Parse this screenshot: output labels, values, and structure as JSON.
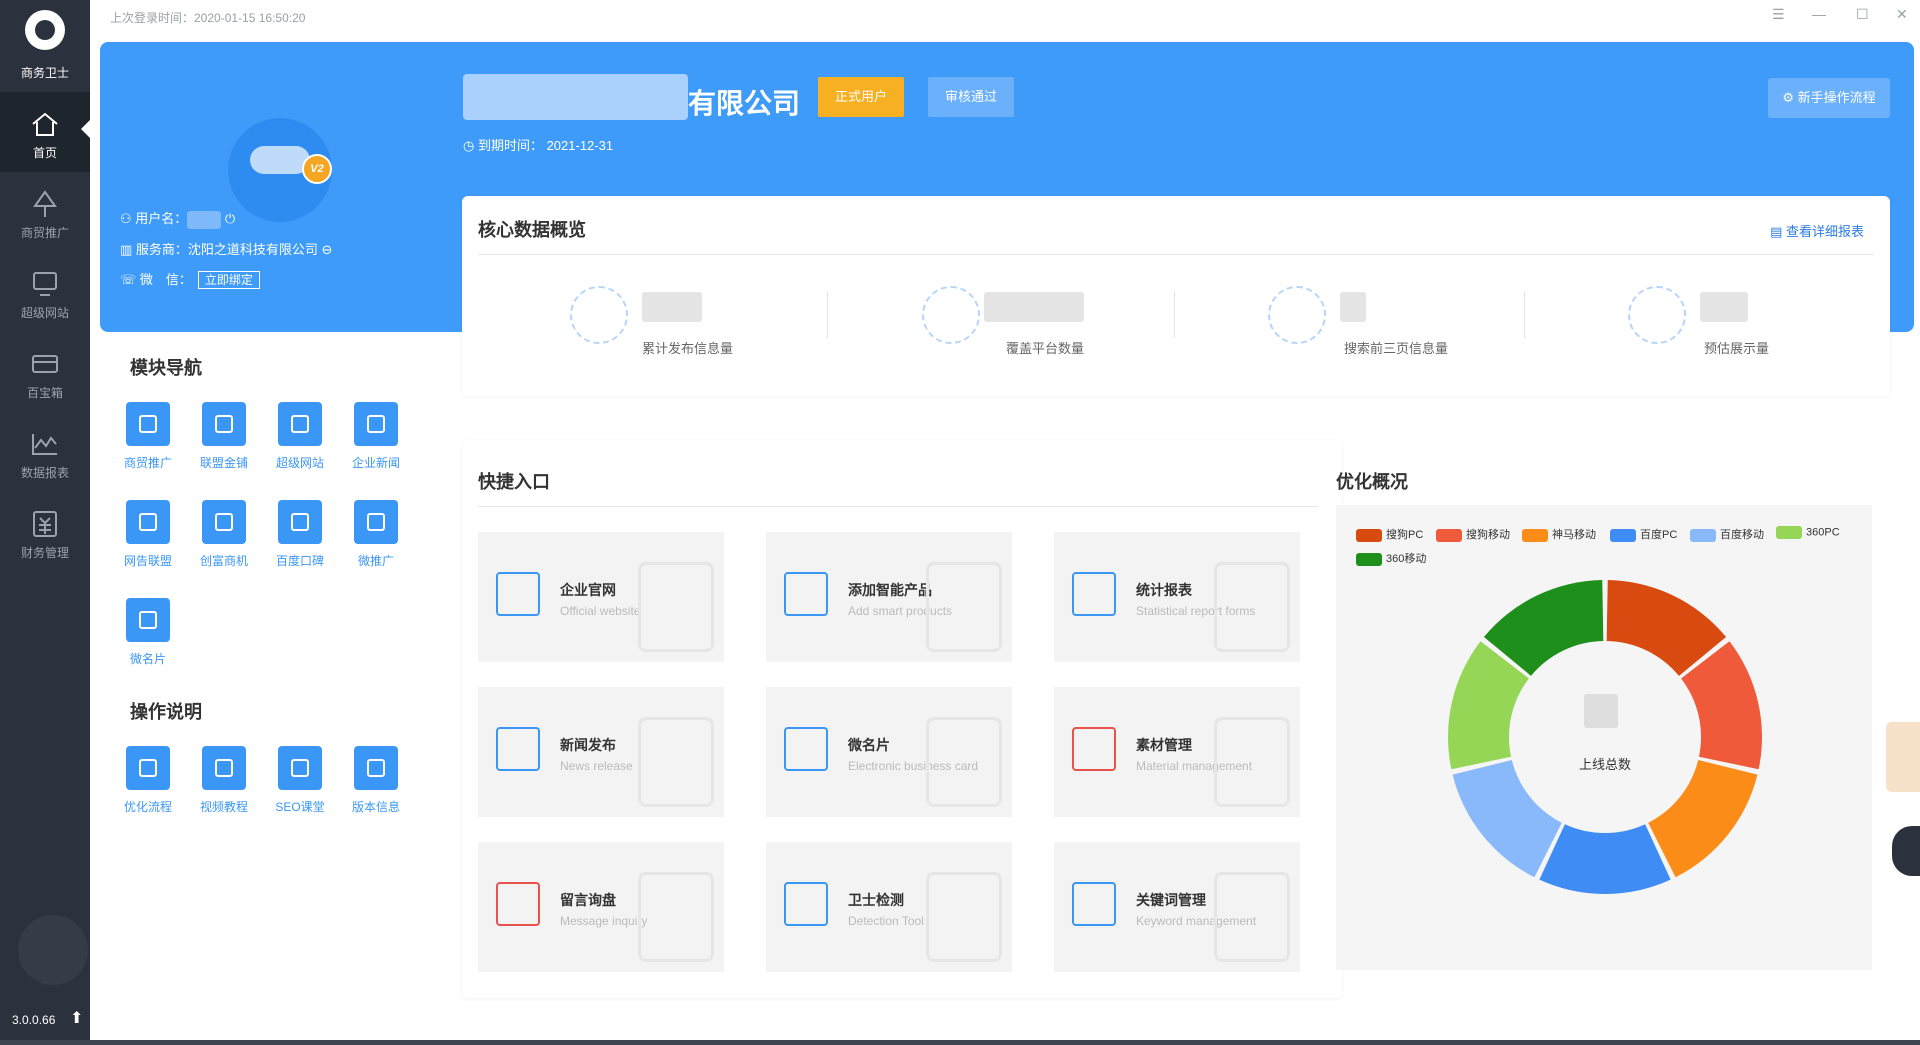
{
  "app": {
    "name": "商务卫士",
    "version": "3.0.0.66"
  },
  "topbar": {
    "last_login": "上次登录时间：2020-01-15 16:50:20"
  },
  "sidebar": {
    "items": [
      {
        "label": "首页",
        "icon": "home-icon"
      },
      {
        "label": "商贸推广",
        "icon": "tree-icon"
      },
      {
        "label": "超级网站",
        "icon": "monitor-icon"
      },
      {
        "label": "百宝箱",
        "icon": "box-icon"
      },
      {
        "label": "数据报表",
        "icon": "chart-icon"
      },
      {
        "label": "财务管理",
        "icon": "finance-icon"
      }
    ]
  },
  "profile": {
    "vip_badge": "V2",
    "username_label": "用户名：",
    "service_label": "服务商：沈阳之道科技有限公司",
    "wechat_label": "微　信：",
    "bind_button": "立即绑定"
  },
  "company": {
    "name_suffix": "有限公司",
    "tag_formal": "正式用户",
    "tag_review": "审核通过",
    "expire": "到期时间： 2021-12-31",
    "guide_button": "新手操作流程"
  },
  "core": {
    "title": "核心数据概览",
    "detail_link": "查看详细报表",
    "stats": [
      {
        "label": "累计发布信息量"
      },
      {
        "label": "覆盖平台数量"
      },
      {
        "label": "搜索前三页信息量"
      },
      {
        "label": "预估展示量"
      }
    ]
  },
  "modules": {
    "title": "模块导航",
    "items": [
      "商贸推广",
      "联盟金铺",
      "超级网站",
      "企业新闻",
      "网告联盟",
      "创富商机",
      "百度口碑",
      "微推广",
      "微名片"
    ]
  },
  "instructions": {
    "title": "操作说明",
    "items": [
      "优化流程",
      "视频教程",
      "SEO课堂",
      "版本信息"
    ]
  },
  "quick": {
    "title": "快捷入口",
    "tiles": [
      {
        "title": "企业官网",
        "subtitle": "Official website"
      },
      {
        "title": "添加智能产品",
        "subtitle": "Add smart products"
      },
      {
        "title": "统计报表",
        "subtitle": "Statistical report forms"
      },
      {
        "title": "新闻发布",
        "subtitle": "News release"
      },
      {
        "title": "微名片",
        "subtitle": "Electronic business card"
      },
      {
        "title": "素材管理",
        "subtitle": "Material management"
      },
      {
        "title": "留言询盘",
        "subtitle": "Message inquiry"
      },
      {
        "title": "卫士检测",
        "subtitle": "Detection Tool"
      },
      {
        "title": "关键词管理",
        "subtitle": "Keyword management"
      }
    ]
  },
  "optimization": {
    "title": "优化概况",
    "center_label": "上线总数"
  },
  "chart_data": {
    "type": "pie",
    "donut": true,
    "categories": [
      "搜狗PC",
      "搜狗移动",
      "神马移动",
      "百度PC",
      "百度移动",
      "360PC",
      "360移动"
    ],
    "values": [
      1,
      1,
      1,
      1,
      1,
      1,
      1
    ],
    "colors": [
      "#d84a0f",
      "#ee5a3a",
      "#fb8c17",
      "#3f8cf5",
      "#8ab9fb",
      "#95d656",
      "#1f8f1c"
    ],
    "legend_position": "top"
  }
}
